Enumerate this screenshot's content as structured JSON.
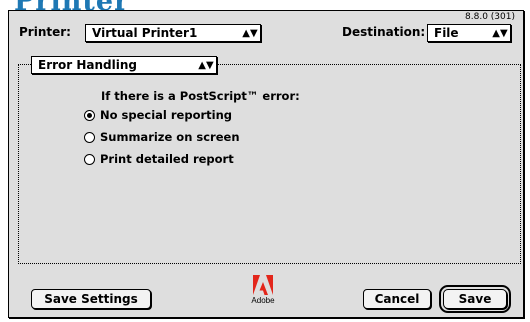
{
  "background_title": "Printer",
  "version": "8.8.0 (301)",
  "printer": {
    "label": "Printer:",
    "value": "Virtual Printer1"
  },
  "destination": {
    "label": "Destination:",
    "value": "File"
  },
  "section": {
    "value": "Error Handling"
  },
  "postscript_error": {
    "prompt": "If there is a PostScript™ error:",
    "options": [
      {
        "label": "No special reporting",
        "selected": true
      },
      {
        "label": "Summarize on screen",
        "selected": false
      },
      {
        "label": "Print detailed report",
        "selected": false
      }
    ]
  },
  "buttons": {
    "save_settings": "Save Settings",
    "cancel": "Cancel",
    "save": "Save"
  },
  "logo": {
    "name": "adobe-logo-icon",
    "word": "Adobe"
  },
  "colors": {
    "dialog_bg": "#dedede",
    "title_blue": "#1e78b4",
    "logo_red": "#e3261b"
  }
}
